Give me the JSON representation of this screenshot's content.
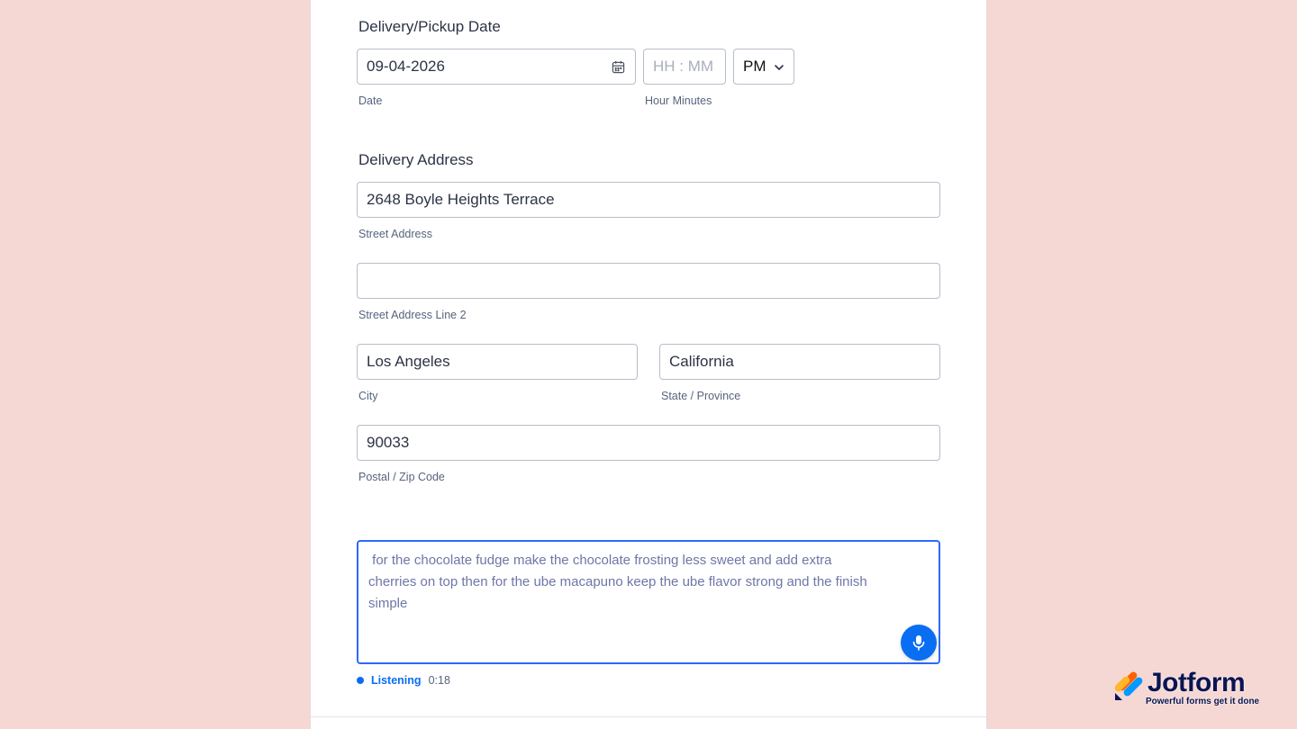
{
  "date_section": {
    "label": "Delivery/Pickup Date",
    "date_value": "09-04-2026",
    "date_sublabel": "Date",
    "time_placeholder": "HH : MM",
    "time_sublabel": "Hour Minutes",
    "ampm_value": "PM"
  },
  "address_section": {
    "label": "Delivery Address",
    "street_value": "2648 Boyle Heights Terrace",
    "street_sublabel": "Street Address",
    "street2_value": "",
    "street2_sublabel": "Street Address Line 2",
    "city_value": "Los Angeles",
    "city_sublabel": "City",
    "state_value": "California",
    "state_sublabel": "State / Province",
    "zip_value": "90033",
    "zip_sublabel": "Postal / Zip Code"
  },
  "notes": {
    "text": " for the chocolate fudge make the chocolate frosting less sweet and add extra cherries on top then for the ube macapuno keep the ube flavor strong and the finish simple",
    "status_label": "Listening",
    "timer": "0:18"
  },
  "brand": {
    "name": "Jotform",
    "tagline": "Powerful forms get it done"
  },
  "colors": {
    "background": "#f5d7d4",
    "accent": "#0a6ef2",
    "focus_border": "#2e69ff"
  },
  "icons": [
    "calendar-icon",
    "chevron-down-icon",
    "microphone-icon",
    "jotform-logo-icon"
  ]
}
